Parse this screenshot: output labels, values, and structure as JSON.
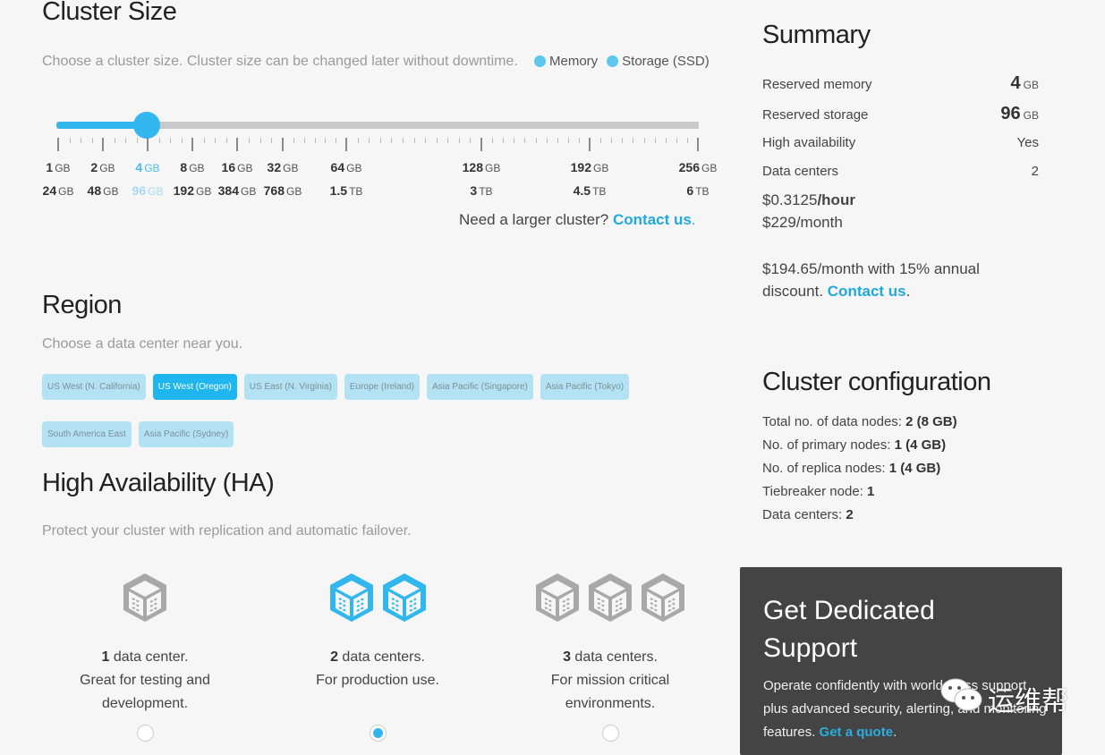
{
  "cluster_size": {
    "title": "Cluster Size",
    "description": "Choose a cluster size. Cluster size can be changed later without downtime.",
    "legend": [
      {
        "label": "Memory",
        "color": "#5cc6ef"
      },
      {
        "label": "Storage (SSD)",
        "color": "#5cc6ef"
      }
    ],
    "slider": {
      "selected_index": 2,
      "selected_memory": "4 GB",
      "selected_storage": "96 GB",
      "stops": [
        {
          "memory_value": "1",
          "memory_unit": "GB",
          "storage_value": "24",
          "storage_unit": "GB"
        },
        {
          "memory_value": "2",
          "memory_unit": "GB",
          "storage_value": "48",
          "storage_unit": "GB"
        },
        {
          "memory_value": "4",
          "memory_unit": "GB",
          "storage_value": "96",
          "storage_unit": "GB"
        },
        {
          "memory_value": "8",
          "memory_unit": "GB",
          "storage_value": "192",
          "storage_unit": "GB"
        },
        {
          "memory_value": "16",
          "memory_unit": "GB",
          "storage_value": "384",
          "storage_unit": "GB"
        },
        {
          "memory_value": "32",
          "memory_unit": "GB",
          "storage_value": "768",
          "storage_unit": "GB"
        },
        {
          "memory_value": "64",
          "memory_unit": "GB",
          "storage_value": "1.5",
          "storage_unit": "TB"
        },
        {
          "memory_value": "128",
          "memory_unit": "GB",
          "storage_value": "3",
          "storage_unit": "TB"
        },
        {
          "memory_value": "192",
          "memory_unit": "GB",
          "storage_value": "4.5",
          "storage_unit": "TB"
        },
        {
          "memory_value": "256",
          "memory_unit": "GB",
          "storage_value": "6",
          "storage_unit": "TB"
        }
      ]
    },
    "larger_prompt": "Need a larger cluster?",
    "larger_link": "Contact us",
    "larger_suffix": "."
  },
  "region": {
    "title": "Region",
    "description": "Choose a data center near you.",
    "options": [
      {
        "label": "US West (N. California)",
        "active": false
      },
      {
        "label": "US West (Oregon)",
        "active": true
      },
      {
        "label": "US East (N. Virginia)",
        "active": false
      },
      {
        "label": "Europe (Ireland)",
        "active": false
      },
      {
        "label": "Asia Pacific (Singapore)",
        "active": false
      },
      {
        "label": "Asia Pacific (Tokyo)",
        "active": false
      },
      {
        "label": "South America East",
        "active": false
      },
      {
        "label": "Asia Pacific (Sydney)",
        "active": false
      }
    ]
  },
  "ha": {
    "title": "High Availability (HA)",
    "description": "Protect your cluster with replication and automatic failover.",
    "options": [
      {
        "count": "1",
        "line1": " data center.",
        "line2": "Great for testing and development.",
        "icon": "data-center-icon",
        "selected": false
      },
      {
        "count": "2",
        "line1": " data centers.",
        "line2": "For production use.",
        "icon": "data-center-icon",
        "selected": true
      },
      {
        "count": "3",
        "line1": " data centers.",
        "line2": "For mission critical environments.",
        "icon": "data-center-icon",
        "selected": false
      }
    ]
  },
  "summary": {
    "title": "Summary",
    "rows": [
      {
        "label": "Reserved memory",
        "value": "4",
        "unit": "GB"
      },
      {
        "label": "Reserved storage",
        "value": "96",
        "unit": "GB"
      },
      {
        "label": "High availability",
        "value": "Yes",
        "unit": ""
      },
      {
        "label": "Data centers",
        "value": "2",
        "unit": ""
      }
    ],
    "hourly_price": "$0.3125",
    "hourly_suffix": "/hour",
    "monthly_price": "$229/month",
    "discount_text": "$194.65/month with 15% annual discount.",
    "discount_link": "Contact us",
    "discount_suffix": "."
  },
  "cluster_config": {
    "title": "Cluster configuration",
    "rows": [
      {
        "label": "Total no. of data nodes: ",
        "value": "2 (8 GB)"
      },
      {
        "label": "No. of primary nodes: ",
        "value": "1 (4 GB)"
      },
      {
        "label": "No. of replica nodes: ",
        "value": "1 (4 GB)"
      },
      {
        "label": "Tiebreaker node: ",
        "value": "1"
      },
      {
        "label": "Data centers: ",
        "value": "2"
      }
    ]
  },
  "support": {
    "title_line1": "Get Dedicated",
    "title_line2": "Support",
    "body": "Operate confidently with world-class support plus advanced security, alerting, and monitoring features.",
    "link": "Get a quote",
    "suffix": "."
  },
  "watermark": {
    "text": "运维帮",
    "icon": "wechat-icon"
  },
  "colors": {
    "accent": "#31b6ee",
    "link": "#23a8dc",
    "region_inactive": "#b3e2f4",
    "region_active": "#1fb6ef",
    "icon_gray": "#a8a8a8",
    "support_bg": "#444444"
  }
}
